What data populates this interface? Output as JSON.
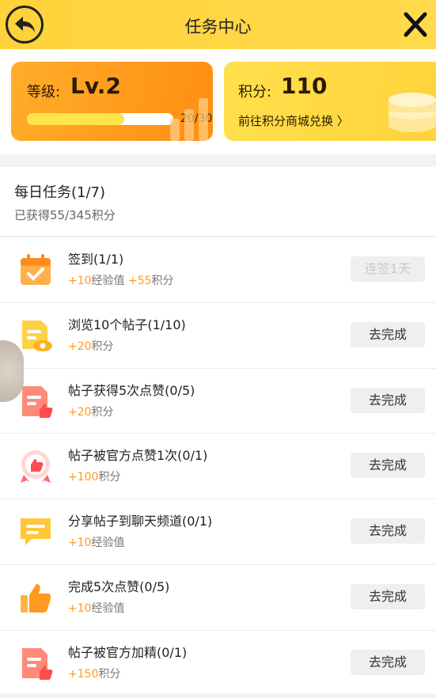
{
  "header": {
    "title": "任务中心"
  },
  "level": {
    "label": "等级:",
    "value": "Lv.2",
    "progress_current": 20,
    "progress_total": 30,
    "progress_text": "20/30",
    "progress_fraction": 0.667
  },
  "points": {
    "label": "积分:",
    "value": "110",
    "link": "前往积分商城兑换 〉"
  },
  "daily": {
    "title": "每日任务(1/7)",
    "subtitle": "已获得55/345积分"
  },
  "tasks": [
    {
      "title": "签到(1/1)",
      "icon": "calendar-check-icon",
      "rewards": [
        [
          "+10",
          "经验值"
        ],
        [
          "+55",
          "积分"
        ]
      ],
      "button": "连签1天",
      "done": true
    },
    {
      "title": "浏览10个帖子(1/10)",
      "icon": "doc-eye-icon",
      "rewards": [
        [
          "+20",
          "积分"
        ]
      ],
      "button": "去完成",
      "done": false
    },
    {
      "title": "帖子获得5次点赞(0/5)",
      "icon": "doc-like-icon",
      "rewards": [
        [
          "+20",
          "积分"
        ]
      ],
      "button": "去完成",
      "done": false
    },
    {
      "title": "帖子被官方点赞1次(0/1)",
      "icon": "badge-like-icon",
      "rewards": [
        [
          "+100",
          "积分"
        ]
      ],
      "button": "去完成",
      "done": false
    },
    {
      "title": "分享帖子到聊天频道(0/1)",
      "icon": "chat-bubble-icon",
      "rewards": [
        [
          "+10",
          "经验值"
        ]
      ],
      "button": "去完成",
      "done": false
    },
    {
      "title": "完成5次点赞(0/5)",
      "icon": "thumbs-up-icon",
      "rewards": [
        [
          "+10",
          "经验值"
        ]
      ],
      "button": "去完成",
      "done": false
    },
    {
      "title": "帖子被官方加精(0/1)",
      "icon": "doc-like-red-icon",
      "rewards": [
        [
          "+150",
          "积分"
        ]
      ],
      "button": "去完成",
      "done": false
    }
  ],
  "colors": {
    "topbar": "#ffd23a",
    "level_card": "#ff9a1e",
    "points_card": "#ffd33a",
    "reward_highlight": "#ff9a1e"
  }
}
